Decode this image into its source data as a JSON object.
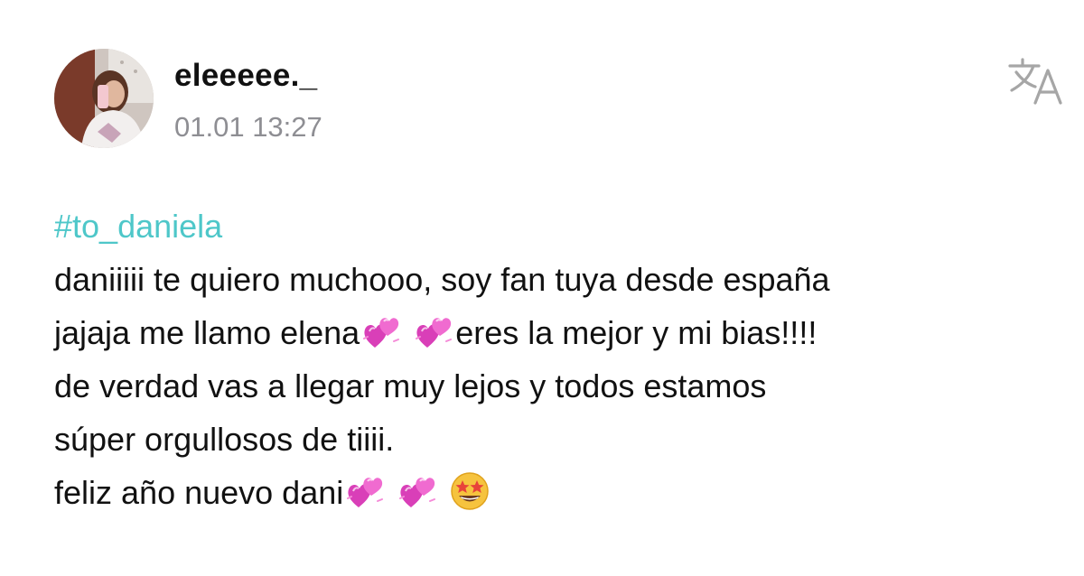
{
  "post": {
    "username": "eleeeee._",
    "timestamp": "01.01 13:27",
    "hashtag": "#to_daniela",
    "lines": {
      "l1": "daniiiii  te quiero muchooo, soy fan tuya desde españa",
      "l2a": "jajaja me llamo elena",
      "l2b": "eres la mejor y mi bias!!!!",
      "l3": "de verdad vas a llegar muy lejos y todos estamos",
      "l4": "súper orgullosos de tiiii.",
      "l5": "feliz año nuevo dani"
    }
  },
  "icons": {
    "avatar": "profile-photo",
    "translate": "translate-icon",
    "heart_emoji": "two-hearts-emoji",
    "star_emoji": "star-struck-emoji"
  },
  "colors": {
    "hashtag": "#4ec7c9",
    "timestamp": "#8e8e93",
    "text": "#111111",
    "translate_icon": "#a6a6a6"
  }
}
